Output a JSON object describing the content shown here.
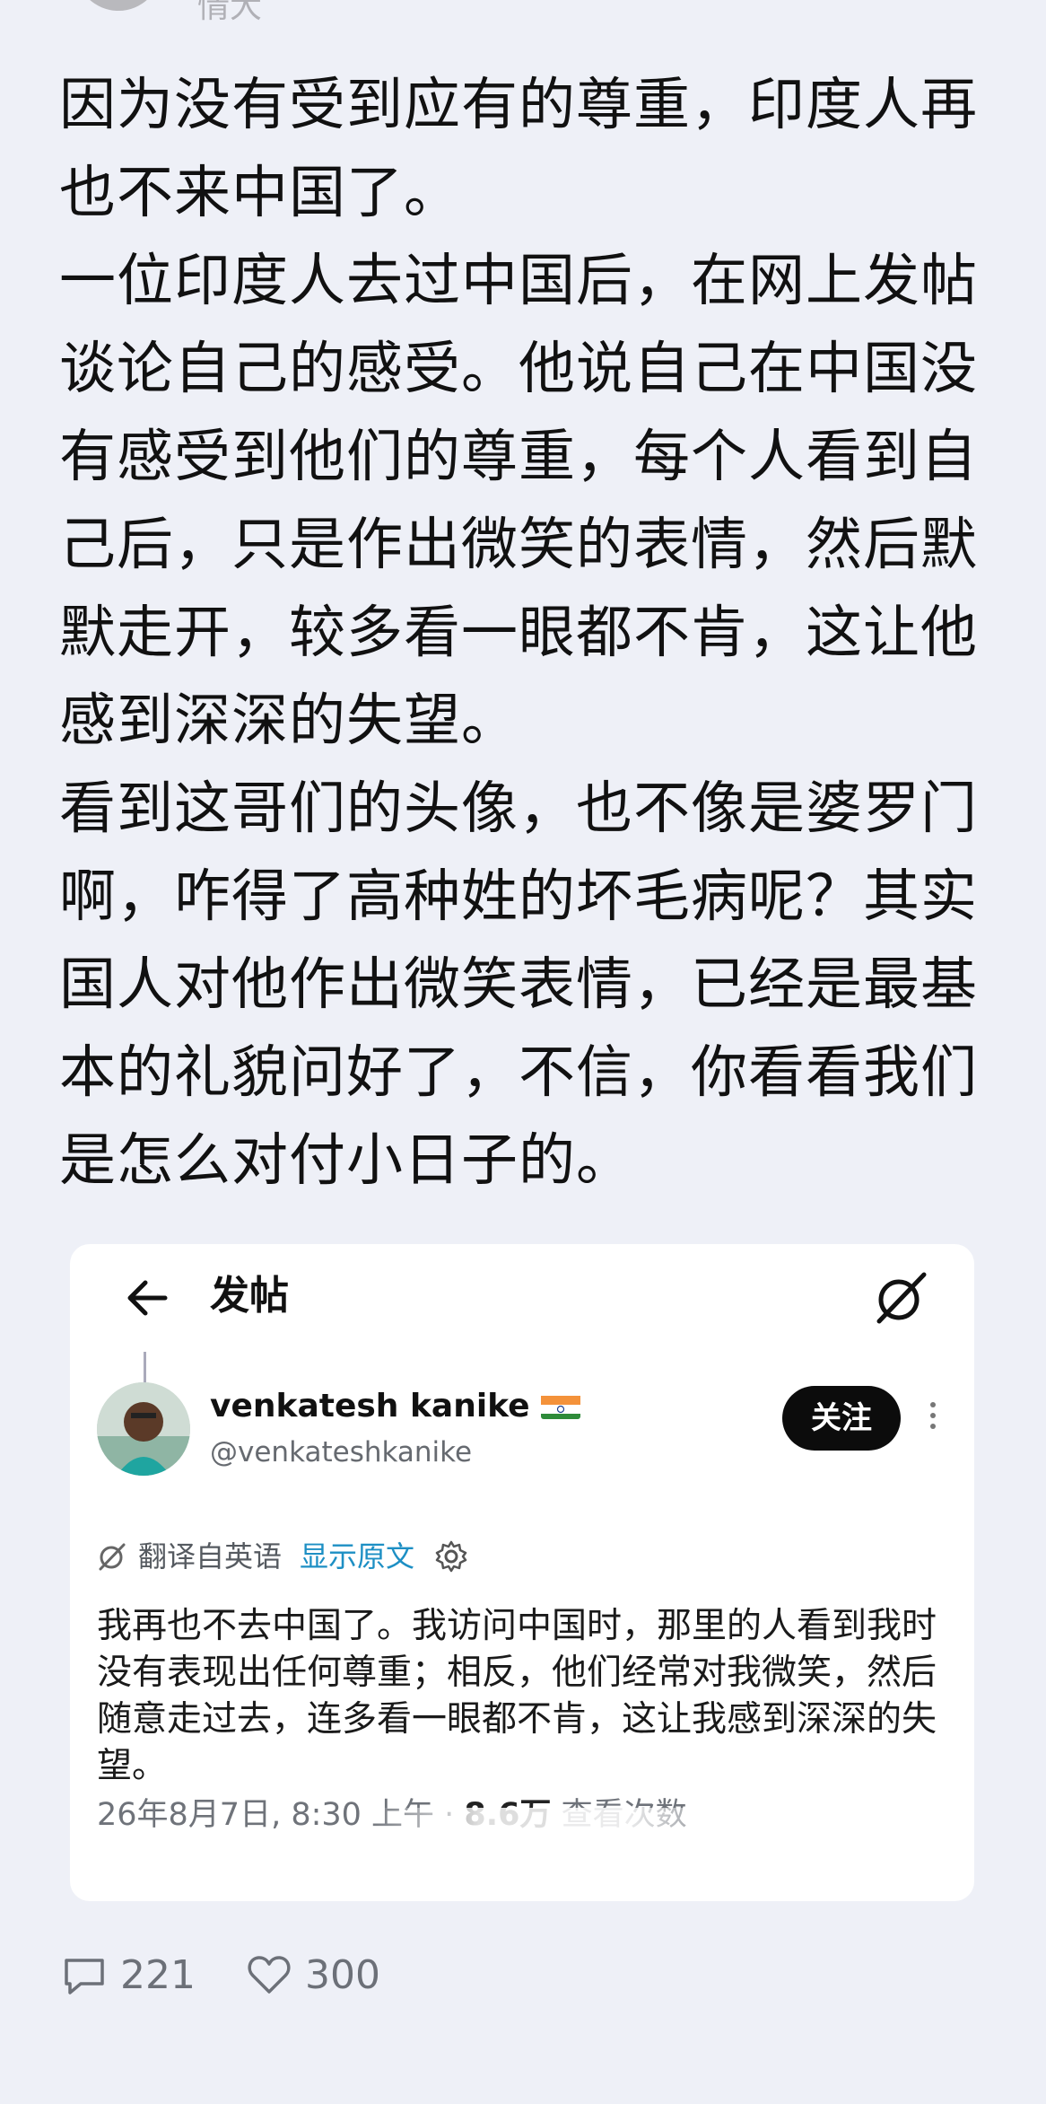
{
  "author_stub": "情大",
  "article": {
    "paragraphs": [
      "因为没有受到应有的尊重，印度人再也不来中国了。",
      "一位印度人去过中国后，在网上发帖谈论自己的感受。他说自己在中国没有感受到他们的尊重，每个人看到自己后，只是作出微笑的表情，然后默默走开，较多看一眼都不肯，这让他感到深深的失望。",
      "看到这哥们的头像，也不像是婆罗门啊，咋得了高种姓的坏毛病呢？其实国人对他作出微笑表情，已经是最基本的礼貌问好了，不信，你看看我们是怎么对付小日子的。"
    ]
  },
  "embedded_post": {
    "header_title": "发帖",
    "user": {
      "name": "venkatesh kanike",
      "handle": "@venkateshkanike",
      "follow_label": "关注"
    },
    "translation": {
      "label": "翻译自英语",
      "show_original": "显示原文"
    },
    "body": "我再也不去中国了。我访问中国时，那里的人看到我时没有表现出任何尊重；相反，他们经常对我微笑，然后随意走过去，连多看一眼都不肯，这让我感到深深的失望。",
    "meta": {
      "datetime": "26年8月7日, 8:30 上午 · ",
      "views": "8.6万",
      "views_label": " 查看次数"
    }
  },
  "footer": {
    "comments": "221",
    "likes": "300"
  },
  "icons": {
    "back": "arrow-left-icon",
    "grok": "grok-icon",
    "translate": "translate-icon",
    "settings": "gear-icon",
    "more": "more-vertical-icon",
    "comment": "comment-icon",
    "like": "heart-icon"
  },
  "colors": {
    "background": "#eef0f7",
    "link": "#1d8fc4",
    "follow_bg": "#0c0c0c"
  }
}
